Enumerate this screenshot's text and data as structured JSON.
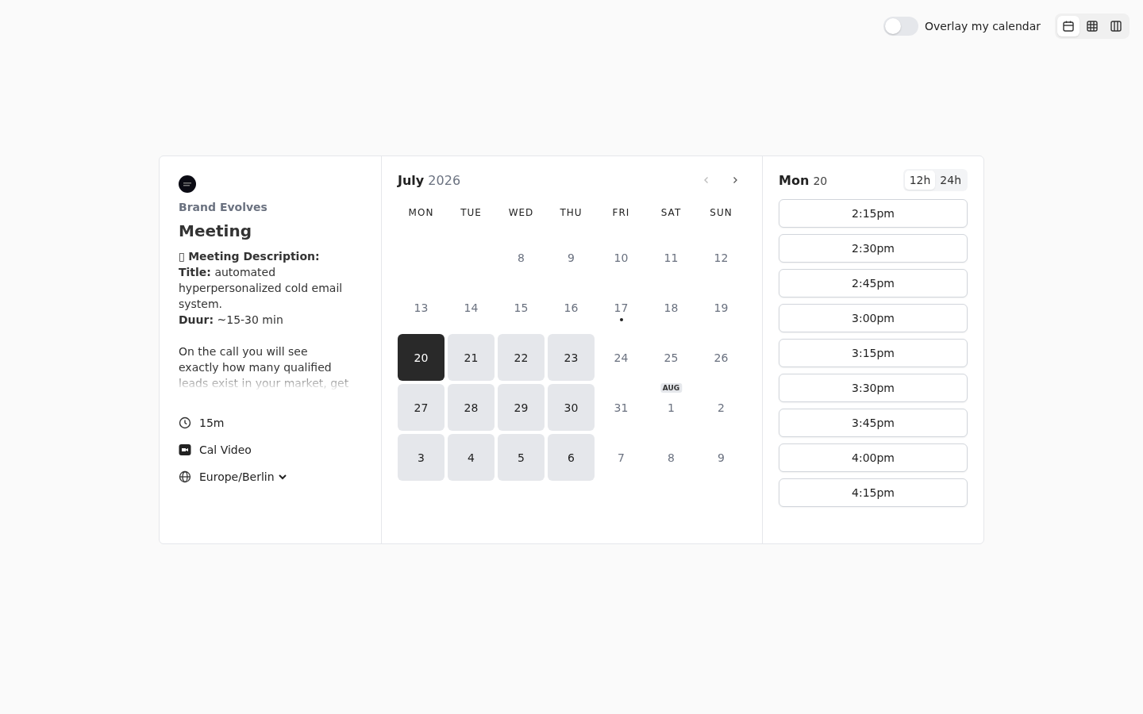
{
  "topbar": {
    "overlay": {
      "label": "Overlay my calendar",
      "on": false
    },
    "views": [
      {
        "kind": "month",
        "selected": true
      },
      {
        "kind": "week",
        "selected": false
      },
      {
        "kind": "column",
        "selected": false
      }
    ]
  },
  "event": {
    "organizer": "Brand Evolves",
    "title": "Meeting",
    "description": [
      {
        "kind": "line",
        "text": "▯ **Meeting Description:**"
      },
      {
        "kind": "line",
        "text": "**Title:** automated hyperpersonalized cold email system."
      },
      {
        "kind": "line",
        "text": "**Duur:** ~15-30 min"
      },
      {
        "kind": "gap"
      },
      {
        "kind": "faded",
        "text": "On the call you will see exactly how many qualified leads exist in your market, get"
      }
    ],
    "details": [
      {
        "kind": "duration",
        "text": "15m"
      },
      {
        "kind": "location",
        "text": "Cal Video"
      },
      {
        "kind": "timezone",
        "text": "Europe/Berlin"
      }
    ]
  },
  "calendar": {
    "month": "July",
    "year": "2026",
    "weekdays": [
      "MON",
      "TUE",
      "WED",
      "THU",
      "FRI",
      "SAT",
      "SUN"
    ],
    "days": [
      {
        "kind": "empty"
      },
      {
        "kind": "empty"
      },
      {
        "kind": "day",
        "label": "8",
        "available": false,
        "selected": false,
        "today": false
      },
      {
        "kind": "day",
        "label": "9",
        "available": false,
        "selected": false,
        "today": false
      },
      {
        "kind": "day",
        "label": "10",
        "available": false,
        "selected": false,
        "today": false
      },
      {
        "kind": "day",
        "label": "11",
        "available": false,
        "selected": false,
        "today": false
      },
      {
        "kind": "day",
        "label": "12",
        "available": false,
        "selected": false,
        "today": false
      },
      {
        "kind": "day",
        "label": "13",
        "available": false,
        "selected": false,
        "today": false
      },
      {
        "kind": "day",
        "label": "14",
        "available": false,
        "selected": false,
        "today": false
      },
      {
        "kind": "day",
        "label": "15",
        "available": false,
        "selected": false,
        "today": false
      },
      {
        "kind": "day",
        "label": "16",
        "available": false,
        "selected": false,
        "today": false
      },
      {
        "kind": "day",
        "label": "17",
        "available": false,
        "selected": false,
        "today": true
      },
      {
        "kind": "day",
        "label": "18",
        "available": false,
        "selected": false,
        "today": false
      },
      {
        "kind": "day",
        "label": "19",
        "available": false,
        "selected": false,
        "today": false
      },
      {
        "kind": "day",
        "label": "20",
        "available": true,
        "selected": true,
        "today": false
      },
      {
        "kind": "day",
        "label": "21",
        "available": true,
        "selected": false,
        "today": false
      },
      {
        "kind": "day",
        "label": "22",
        "available": true,
        "selected": false,
        "today": false
      },
      {
        "kind": "day",
        "label": "23",
        "available": true,
        "selected": false,
        "today": false
      },
      {
        "kind": "day",
        "label": "24",
        "available": false,
        "selected": false,
        "today": false
      },
      {
        "kind": "day",
        "label": "25",
        "available": false,
        "selected": false,
        "today": false
      },
      {
        "kind": "day",
        "label": "26",
        "available": false,
        "selected": false,
        "today": false
      },
      {
        "kind": "day",
        "label": "27",
        "available": true,
        "selected": false,
        "today": false
      },
      {
        "kind": "day",
        "label": "28",
        "available": true,
        "selected": false,
        "today": false
      },
      {
        "kind": "day",
        "label": "29",
        "available": true,
        "selected": false,
        "today": false
      },
      {
        "kind": "day",
        "label": "30",
        "available": true,
        "selected": false,
        "today": false
      },
      {
        "kind": "day",
        "label": "31",
        "available": false,
        "selected": false,
        "today": false
      },
      {
        "kind": "day",
        "label": "1",
        "month_badge": "AUG",
        "available": false,
        "selected": false,
        "today": false
      },
      {
        "kind": "day",
        "label": "2",
        "available": false,
        "selected": false,
        "today": false
      },
      {
        "kind": "day",
        "label": "3",
        "available": true,
        "selected": false,
        "today": false
      },
      {
        "kind": "day",
        "label": "4",
        "available": true,
        "selected": false,
        "today": false
      },
      {
        "kind": "day",
        "label": "5",
        "available": true,
        "selected": false,
        "today": false
      },
      {
        "kind": "day",
        "label": "6",
        "available": true,
        "selected": false,
        "today": false
      },
      {
        "kind": "day",
        "label": "7",
        "available": false,
        "selected": false,
        "today": false
      },
      {
        "kind": "day",
        "label": "8",
        "available": false,
        "selected": false,
        "today": false
      },
      {
        "kind": "day",
        "label": "9",
        "available": false,
        "selected": false,
        "today": false
      }
    ]
  },
  "slots": {
    "weekday": "Mon",
    "date": "20",
    "formats": [
      {
        "label": "12h",
        "selected": true
      },
      {
        "label": "24h",
        "selected": false
      }
    ],
    "times": [
      "2:15pm",
      "2:30pm",
      "2:45pm",
      "3:00pm",
      "3:15pm",
      "3:30pm",
      "3:45pm",
      "4:00pm",
      "4:15pm"
    ]
  }
}
